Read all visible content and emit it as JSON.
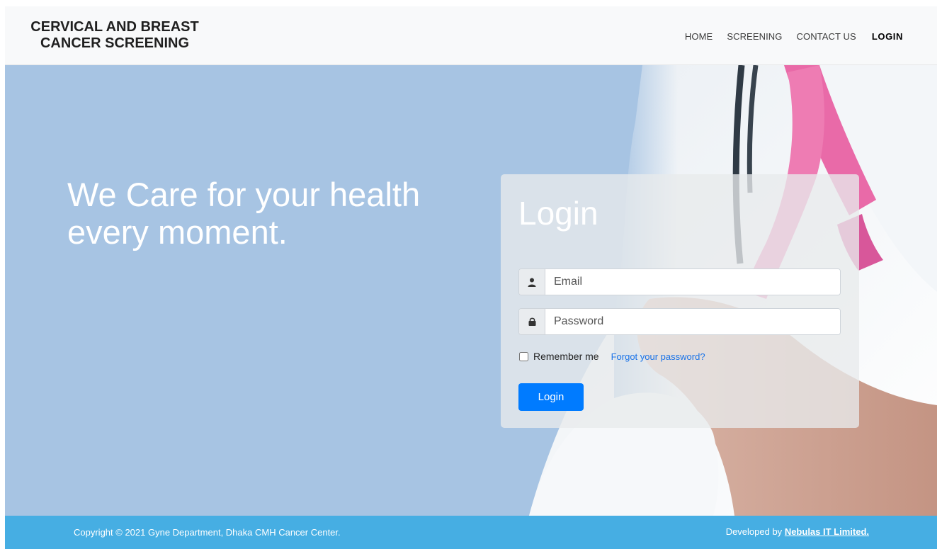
{
  "header": {
    "brand_line1": "CERVICAL AND BREAST",
    "brand_line2": "CANCER SCREENING",
    "nav": [
      {
        "label": "HOME"
      },
      {
        "label": "SCREENING"
      },
      {
        "label": "CONTACT US"
      },
      {
        "label": "LOGIN"
      }
    ]
  },
  "hero": {
    "tagline_line1": "We Care for your health",
    "tagline_line2": "every moment."
  },
  "login": {
    "title": "Login",
    "email_placeholder": "Email",
    "password_placeholder": "Password",
    "remember_label": "Remember me",
    "forgot_link": "Forgot your password?",
    "submit_label": "Login",
    "icons": {
      "email": "user-icon",
      "password": "lock-icon"
    }
  },
  "footer": {
    "copyright": "Copyright © 2021 Gyne Department, Dhaka CMH Cancer Center.",
    "developed_prefix": "Developed by ",
    "developer_link": "Nebulas IT Limited."
  },
  "colors": {
    "hero_bg": "#a7c4e3",
    "footer_bg": "#46aee3",
    "primary_button": "#007bff",
    "link": "#1a73e8",
    "ribbon": "#e96aa8"
  }
}
